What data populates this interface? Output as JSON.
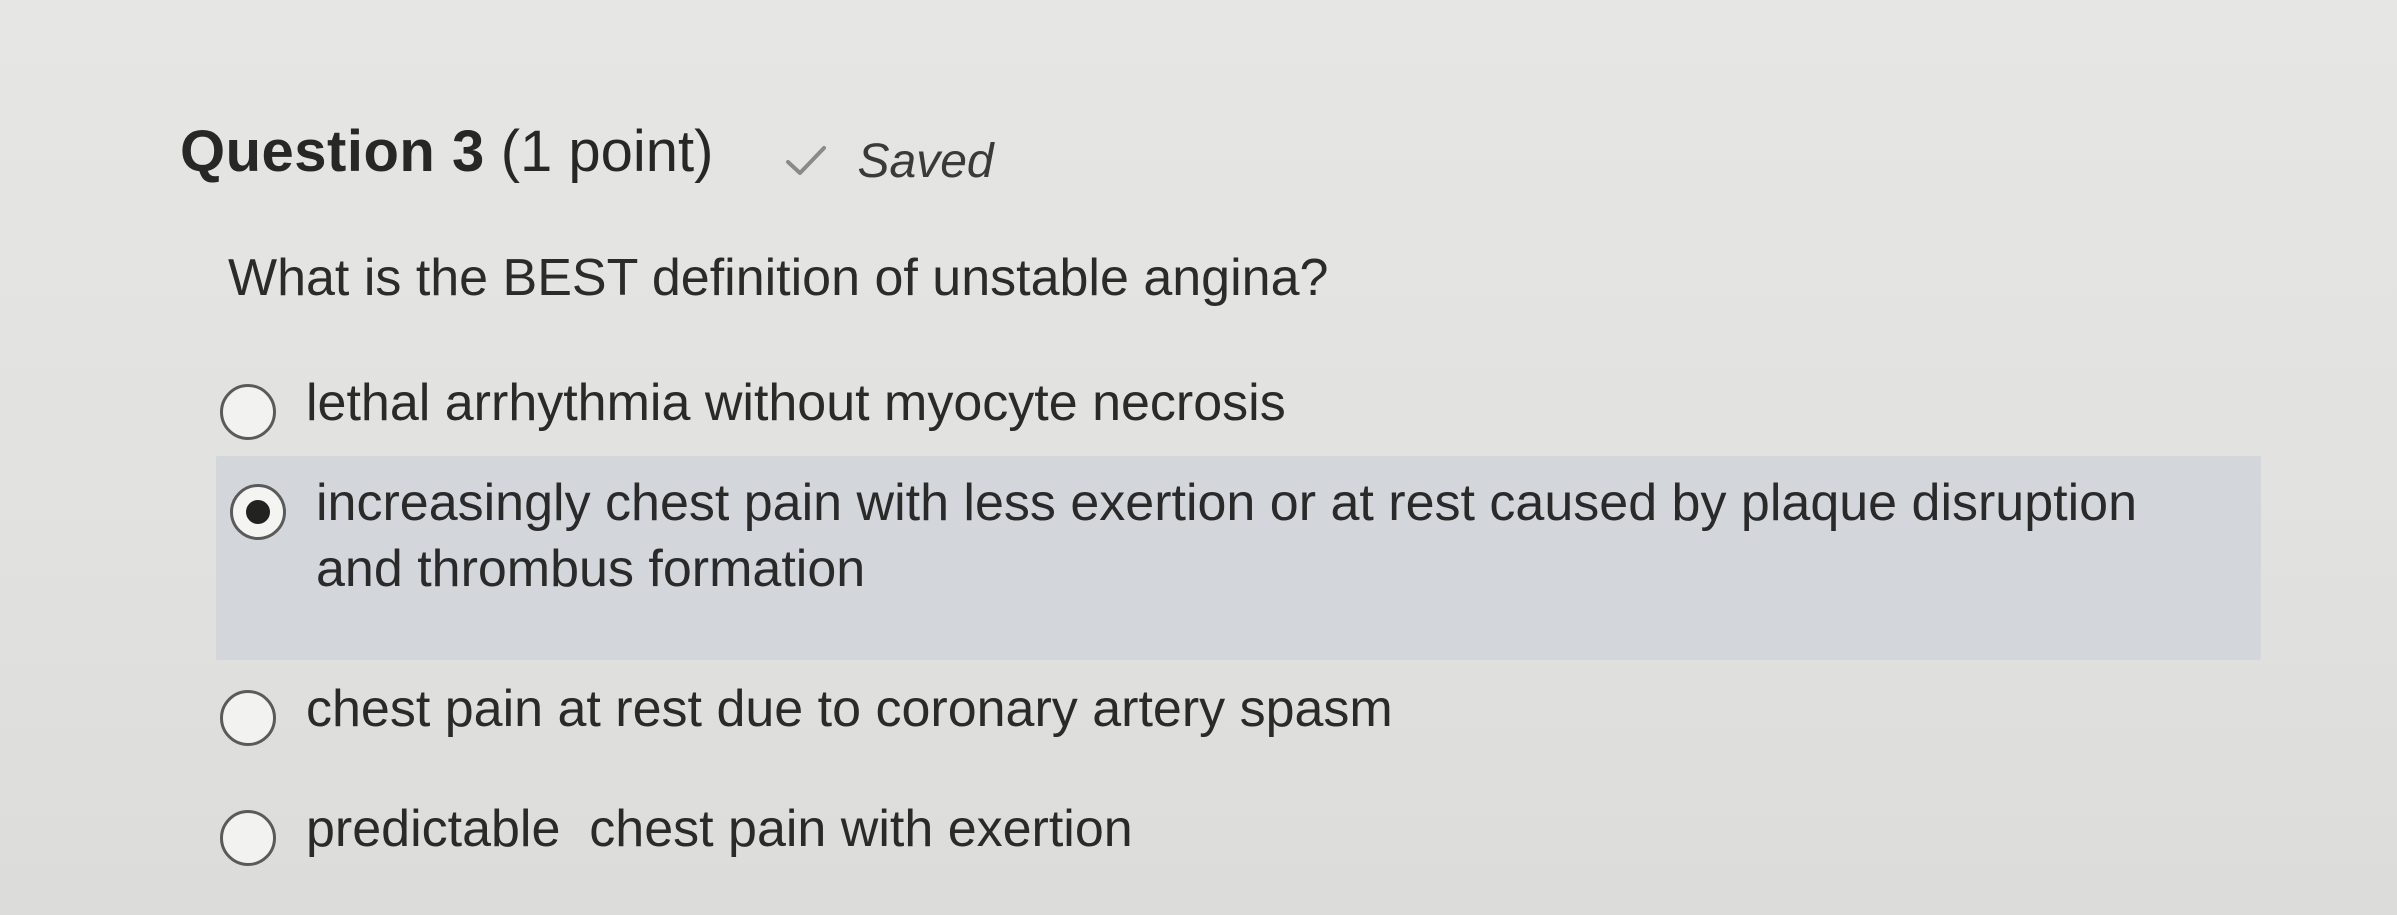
{
  "question": {
    "title": "Question 3",
    "points": "(1 point)",
    "status": "Saved",
    "status_icon": "checkmark-icon",
    "prompt": "What is the BEST definition of unstable angina?"
  },
  "options": [
    {
      "label": "lethal arrhythmia without myocyte necrosis",
      "selected": false
    },
    {
      "label": "increasingly chest pain with less exertion or at rest caused by plaque disruption and thrombus formation",
      "selected": true
    },
    {
      "label": "chest pain at rest due to coronary artery spasm",
      "selected": false
    },
    {
      "label": "predictable  chest pain with exertion",
      "selected": false
    }
  ],
  "colors": {
    "background": "#e4e4e2",
    "selected_highlight": "#d3d7dc",
    "text": "#2a2a2a"
  }
}
